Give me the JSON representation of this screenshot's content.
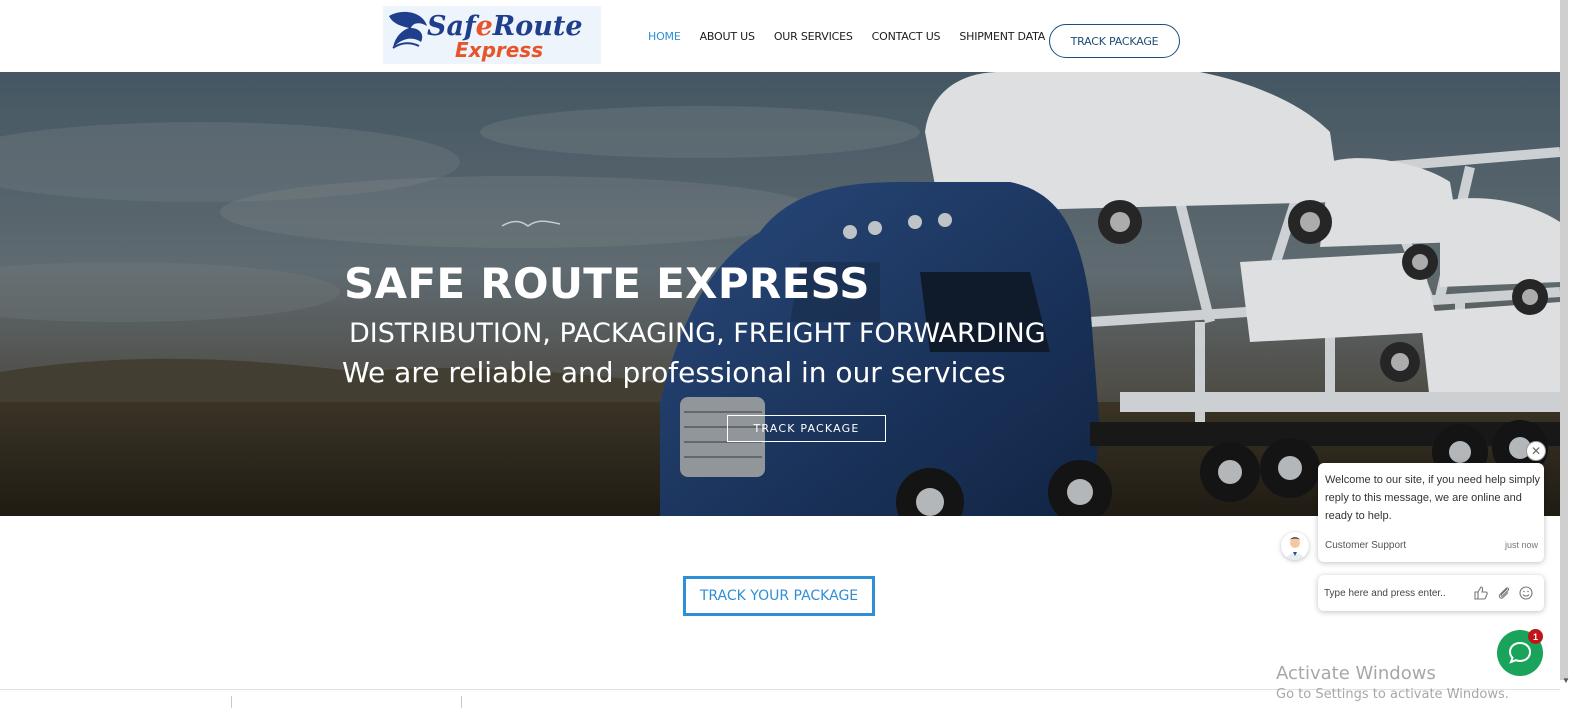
{
  "header": {
    "logo_text_1": "SafeRoute",
    "logo_text_2": "Express",
    "nav": [
      {
        "label": "HOME",
        "active": true
      },
      {
        "label": "ABOUT US"
      },
      {
        "label": "OUR SERVICES"
      },
      {
        "label": "CONTACT US"
      },
      {
        "label": "SHIPMENT DATA"
      }
    ],
    "track_button": "TRACK PACKAGE"
  },
  "hero": {
    "title": "SAFE ROUTE EXPRESS",
    "subtitle": "DISTRIBUTION, PACKAGING, FREIGHT FORWARDING",
    "tagline": "We are reliable and professional in our services",
    "button": "TRACK PACKAGE"
  },
  "main": {
    "track_your_package": "TRACK YOUR PACKAGE"
  },
  "chat": {
    "message": "Welcome to our site, if you need help simply reply to this message, we are online and ready to help.",
    "agent": "Customer Support",
    "time": "just now",
    "input_placeholder": "Type here and press enter..",
    "badge_count": "1",
    "close_glyph": "✕"
  },
  "watermark": {
    "title": "Activate Windows",
    "subtitle": "Go to Settings to activate Windows."
  },
  "colors": {
    "accent": "#2e8fd6",
    "nav_button_border": "#1b4d7a",
    "chat_green": "#1aa35a",
    "badge_red": "#c0141b"
  }
}
